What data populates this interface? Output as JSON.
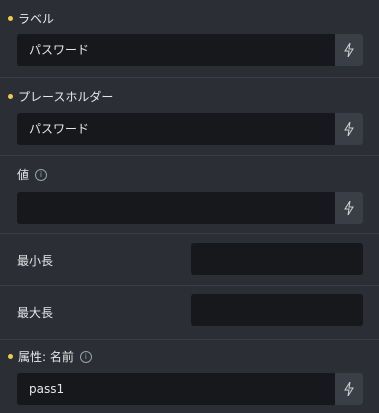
{
  "fields": {
    "label": {
      "title": "ラベル",
      "value": "パスワード"
    },
    "placeholder": {
      "title": "プレースホルダー",
      "value": "パスワード"
    },
    "value": {
      "title": "値",
      "value": ""
    },
    "minlength": {
      "title": "最小長",
      "value": ""
    },
    "maxlength": {
      "title": "最大長",
      "value": ""
    },
    "name_attr": {
      "title": "属性: 名前",
      "value": "pass1"
    }
  },
  "icons": {
    "dynamic": "lightning-icon",
    "info": "info-icon"
  },
  "colors": {
    "modified_dot": "#f2c94c",
    "panel_bg": "#2b2e34",
    "input_bg": "#16181c"
  }
}
